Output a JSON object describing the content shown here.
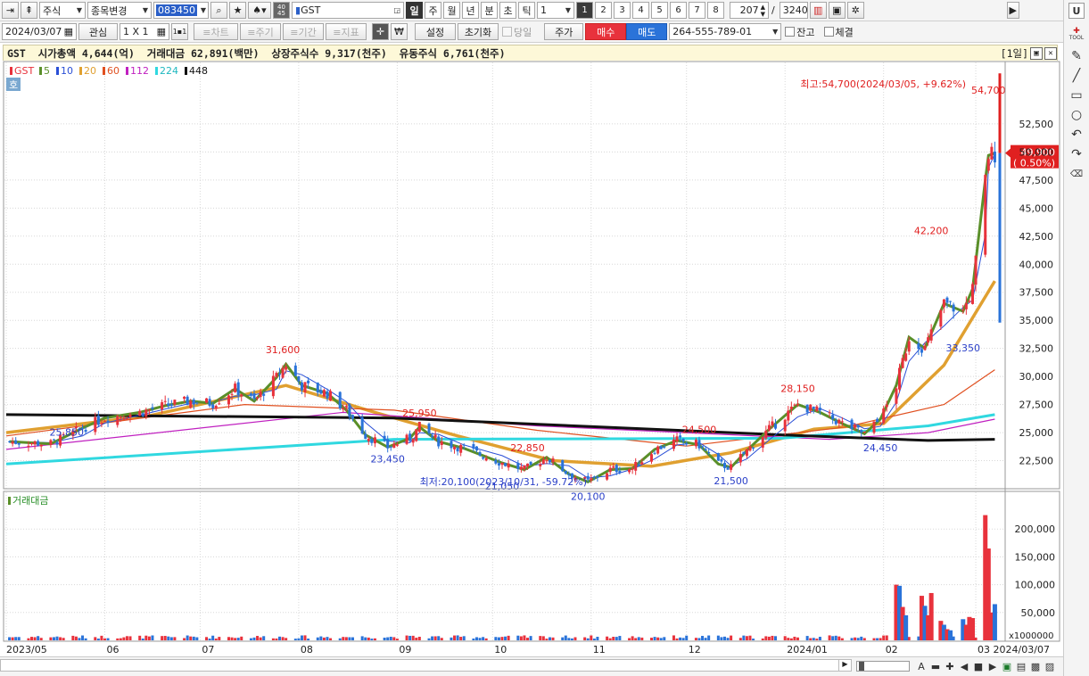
{
  "toolbar1": {
    "market": "주식",
    "change_label": "종목변경",
    "code": "083450",
    "name": "GST",
    "badge": "40\n45",
    "periods": [
      "일",
      "주",
      "월",
      "년",
      "분",
      "초",
      "틱"
    ],
    "period_count": "1",
    "numbers": [
      "1",
      "2",
      "3",
      "4",
      "5",
      "6",
      "7",
      "8"
    ],
    "page_current": "207",
    "page_sep": "/",
    "page_total": "3240",
    "u_label": "U"
  },
  "toolbar2": {
    "date": "2024/03/07",
    "watch_label": "관심",
    "grid_label": "1 X 1",
    "chart_label": "≡차트",
    "cycle_label": "≡주기",
    "range_label": "≡기간",
    "indicator_label": "≡지표",
    "won_label": "₩",
    "settings_label": "설정",
    "reset_label": "초기화",
    "sameday_label": "당일",
    "price_label": "주가",
    "buy_label": "매수",
    "sell_label": "매도",
    "account": "264-555-789-01",
    "balance_label": "잔고",
    "filled_label": "체결"
  },
  "infobar": {
    "text": "GST  시가총액 4,644(억)  거래대금 62,891(백만)  상장주식수 9,317(천주)  유동주식 6,761(천주)",
    "period": "[1일]"
  },
  "legend": {
    "items": [
      {
        "label": "GST",
        "color": "#e8323c"
      },
      {
        "label": "5",
        "color": "#5a8f29"
      },
      {
        "label": "10",
        "color": "#2a4fd6"
      },
      {
        "label": "20",
        "color": "#e0a030"
      },
      {
        "label": "60",
        "color": "#e05020"
      },
      {
        "label": "112",
        "color": "#c020c0"
      },
      {
        "label": "224",
        "color": "#30d8e0"
      },
      {
        "label": "448",
        "color": "#111111"
      }
    ],
    "ho_label": "호"
  },
  "volume_legend": "거래대금",
  "annotations": {
    "high": "최고:54,700(2024/03/05, +9.62%)",
    "low": "최저:20,100(2023/10/31, -59.72%)",
    "current_price": "49,900",
    "current_change": "( 0.50%)",
    "volume_unit": "x1000000"
  },
  "chart_data": [
    {
      "type": "candlestick",
      "title": "GST",
      "x_tick_labels": [
        "2023/05",
        "06",
        "07",
        "08",
        "09",
        "10",
        "11",
        "12",
        "2024/01",
        "02",
        "03 2024/03/07"
      ],
      "y_tick_labels": [
        "52,500",
        "50,000",
        "47,500",
        "45,000",
        "42,500",
        "40,000",
        "37,500",
        "35,000",
        "32,500",
        "30,000",
        "27,500",
        "25,000",
        "22,500"
      ],
      "ylim": [
        20000,
        57500
      ],
      "close_path": [
        [
          "2023-05-02",
          24200
        ],
        [
          "2023-05-15",
          24000
        ],
        [
          "2023-05-25",
          25400
        ],
        [
          "2023-06-01",
          26300
        ],
        [
          "2023-06-12",
          26800
        ],
        [
          "2023-06-20",
          27400
        ],
        [
          "2023-06-28",
          27800
        ],
        [
          "2023-07-05",
          27600
        ],
        [
          "2023-07-12",
          28900
        ],
        [
          "2023-07-18",
          27800
        ],
        [
          "2023-07-25",
          29900
        ],
        [
          "2023-07-28",
          31100
        ],
        [
          "2023-08-02",
          29200
        ],
        [
          "2023-08-10",
          28500
        ],
        [
          "2023-08-16",
          27000
        ],
        [
          "2023-08-22",
          24800
        ],
        [
          "2023-08-29",
          23700
        ],
        [
          "2023-09-05",
          24500
        ],
        [
          "2023-09-08",
          25500
        ],
        [
          "2023-09-14",
          24200
        ],
        [
          "2023-09-22",
          23600
        ],
        [
          "2023-10-04",
          22300
        ],
        [
          "2023-10-11",
          21700
        ],
        [
          "2023-10-18",
          22800
        ],
        [
          "2023-10-25",
          21300
        ],
        [
          "2023-10-31",
          20600
        ],
        [
          "2023-11-07",
          21700
        ],
        [
          "2023-11-14",
          21800
        ],
        [
          "2023-11-21",
          23500
        ],
        [
          "2023-11-28",
          24300
        ],
        [
          "2023-12-05",
          23900
        ],
        [
          "2023-12-11",
          22200
        ],
        [
          "2023-12-15",
          21900
        ],
        [
          "2023-12-20",
          23400
        ],
        [
          "2023-12-27",
          25300
        ],
        [
          "2024-01-05",
          27500
        ],
        [
          "2024-01-12",
          26800
        ],
        [
          "2024-01-19",
          25800
        ],
        [
          "2024-01-26",
          24900
        ],
        [
          "2024-01-31",
          26200
        ],
        [
          "2024-02-05",
          29200
        ],
        [
          "2024-02-09",
          33500
        ],
        [
          "2024-02-14",
          32500
        ],
        [
          "2024-02-20",
          36500
        ],
        [
          "2024-02-26",
          35800
        ],
        [
          "2024-02-29",
          37800
        ],
        [
          "2024-03-04",
          47500
        ],
        [
          "2024-03-05",
          49700
        ],
        [
          "2024-03-07",
          49900
        ]
      ],
      "ma_series": [
        {
          "name": "20",
          "color": "#e0a030",
          "points": [
            [
              "2023-05-01",
              25000
            ],
            [
              "2023-06-15",
              26500
            ],
            [
              "2023-07-28",
              29200
            ],
            [
              "2023-08-25",
              26800
            ],
            [
              "2023-09-20",
              24700
            ],
            [
              "2023-10-20",
              22500
            ],
            [
              "2023-11-20",
              22000
            ],
            [
              "2023-12-15",
              23200
            ],
            [
              "2024-01-10",
              25300
            ],
            [
              "2024-02-01",
              25800
            ],
            [
              "2024-02-20",
              31000
            ],
            [
              "2024-03-07",
              38500
            ]
          ]
        },
        {
          "name": "60",
          "color": "#e05020",
          "points": [
            [
              "2023-05-01",
              24700
            ],
            [
              "2023-07-15",
              27500
            ],
            [
              "2023-08-31",
              27000
            ],
            [
              "2023-10-15",
              25200
            ],
            [
              "2023-12-01",
              23800
            ],
            [
              "2024-01-20",
              25500
            ],
            [
              "2024-02-20",
              27500
            ],
            [
              "2024-03-07",
              30600
            ]
          ]
        },
        {
          "name": "112",
          "color": "#c020c0",
          "points": [
            [
              "2023-05-01",
              23500
            ],
            [
              "2023-08-15",
              26800
            ],
            [
              "2023-10-15",
              25600
            ],
            [
              "2024-01-15",
              24400
            ],
            [
              "2024-02-15",
              25000
            ],
            [
              "2024-03-07",
              26200
            ]
          ]
        },
        {
          "name": "224",
          "color": "#30d8e0",
          "points": [
            [
              "2023-05-01",
              22200
            ],
            [
              "2023-08-31",
              24400
            ],
            [
              "2023-12-31",
              24500
            ],
            [
              "2024-02-15",
              25600
            ],
            [
              "2024-03-07",
              26600
            ]
          ]
        },
        {
          "name": "448",
          "color": "#111111",
          "points": [
            [
              "2023-05-01",
              26600
            ],
            [
              "2023-08-31",
              26300
            ],
            [
              "2023-12-31",
              24800
            ],
            [
              "2024-02-15",
              24300
            ],
            [
              "2024-03-07",
              24400
            ]
          ]
        }
      ],
      "value_labels": [
        {
          "date": "2023-05-20",
          "value": 25850,
          "text": "25,850",
          "color": "#2a3fc8"
        },
        {
          "date": "2023-07-27",
          "value": 31600,
          "text": "31,600",
          "color": "#e02020"
        },
        {
          "date": "2023-08-29",
          "value": 23450,
          "text": "23,450",
          "color": "#2a3fc8"
        },
        {
          "date": "2023-09-08",
          "value": 25950,
          "text": "25,950",
          "color": "#e02020"
        },
        {
          "date": "2023-10-12",
          "value": 22850,
          "text": "22,850",
          "color": "#e02020"
        },
        {
          "date": "2023-10-04",
          "value": 21050,
          "text": "21,050",
          "color": "#2a3fc8"
        },
        {
          "date": "2023-10-31",
          "value": 20100,
          "text": "20,100",
          "color": "#2a3fc8"
        },
        {
          "date": "2023-12-05",
          "value": 24500,
          "text": "24,500",
          "color": "#e02020"
        },
        {
          "date": "2023-12-15",
          "value": 21500,
          "text": "21,500",
          "color": "#2a3fc8"
        },
        {
          "date": "2024-01-05",
          "value": 28150,
          "text": "28,150",
          "color": "#e02020"
        },
        {
          "date": "2024-01-31",
          "value": 24450,
          "text": "24,450",
          "color": "#2a3fc8"
        },
        {
          "date": "2024-02-16",
          "value": 42200,
          "text": "42,200",
          "color": "#e02020"
        },
        {
          "date": "2024-02-26",
          "value": 33350,
          "text": "33,350",
          "color": "#2a3fc8"
        },
        {
          "date": "2024-03-05",
          "value": 54700,
          "text": "54,700",
          "color": "#e02020"
        }
      ]
    },
    {
      "type": "bar",
      "title": "거래대금",
      "y_tick_labels": [
        "200,000",
        "150,000",
        "100,000",
        "50,000"
      ],
      "ylim": [
        0,
        250000
      ],
      "unit_label": "x1000000",
      "bars": [
        [
          "2024-02-05",
          100000,
          "up"
        ],
        [
          "2024-02-06",
          98000,
          "down"
        ],
        [
          "2024-02-07",
          60000,
          "up"
        ],
        [
          "2024-02-08",
          45000,
          "down"
        ],
        [
          "2024-02-13",
          80000,
          "up"
        ],
        [
          "2024-02-14",
          62000,
          "down"
        ],
        [
          "2024-02-15",
          45000,
          "up"
        ],
        [
          "2024-02-16",
          85000,
          "up"
        ],
        [
          "2024-02-19",
          35000,
          "up"
        ],
        [
          "2024-02-20",
          28000,
          "down"
        ],
        [
          "2024-02-21",
          20000,
          "up"
        ],
        [
          "2024-02-22",
          18000,
          "down"
        ],
        [
          "2024-02-26",
          38000,
          "down"
        ],
        [
          "2024-02-27",
          28000,
          "up"
        ],
        [
          "2024-02-28",
          42000,
          "up"
        ],
        [
          "2024-02-29",
          40000,
          "up"
        ],
        [
          "2024-03-04",
          225000,
          "up"
        ],
        [
          "2024-03-05",
          165000,
          "up"
        ],
        [
          "2024-03-06",
          50000,
          "up"
        ],
        [
          "2024-03-07",
          65000,
          "down"
        ]
      ]
    }
  ]
}
